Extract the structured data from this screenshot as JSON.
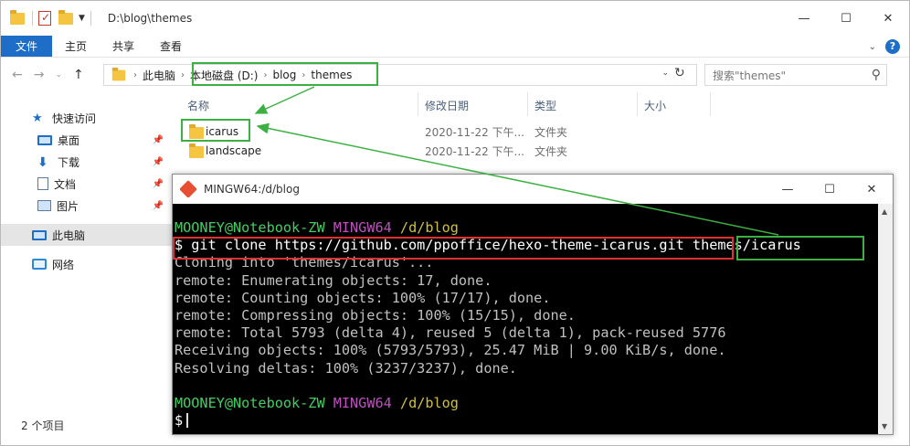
{
  "explorer": {
    "title_path": "D:\\blog\\themes",
    "ribbon_tabs": [
      "文件",
      "主页",
      "共享",
      "查看"
    ],
    "breadcrumbs": [
      "此电脑",
      "本地磁盘 (D:)",
      "blog",
      "themes"
    ],
    "search_placeholder": "搜索\"themes\"",
    "columns": {
      "name": "名称",
      "date": "修改日期",
      "type": "类型",
      "size": "大小"
    },
    "files": [
      {
        "name": "icarus",
        "date": "2020-11-22 下午...",
        "type": "文件夹"
      },
      {
        "name": "landscape",
        "date": "2020-11-22 下午...",
        "type": "文件夹"
      }
    ],
    "sidebar": {
      "quick_access": "快速访问",
      "items": [
        "桌面",
        "下载",
        "文档",
        "图片"
      ],
      "this_pc": "此电脑",
      "network": "网络"
    },
    "status_text": "2 个项目"
  },
  "terminal": {
    "title": "MINGW64:/d/blog",
    "prompt_user": "MOONEY@Notebook-ZW",
    "prompt_env": "MINGW64",
    "prompt_path": "/d/blog",
    "command": "$ git clone https://github.com/ppoffice/hexo-theme-icarus.git",
    "command_arg": "themes/icarus",
    "output": [
      "Cloning into 'themes/icarus'...",
      "remote: Enumerating objects: 17, done.",
      "remote: Counting objects: 100% (17/17), done.",
      "remote: Compressing objects: 100% (15/15), done.",
      "remote: Total 5793 (delta 4), reused 5 (delta 1), pack-reused 5776",
      "Receiving objects: 100% (5793/5793), 25.47 MiB | 9.00 KiB/s, done.",
      "Resolving deltas: 100% (3237/3237), done."
    ],
    "final_prompt": "$"
  },
  "colors": {
    "annotation_green": "#3cb043",
    "annotation_red": "#e03030",
    "accent_blue": "#1e6ec7"
  }
}
